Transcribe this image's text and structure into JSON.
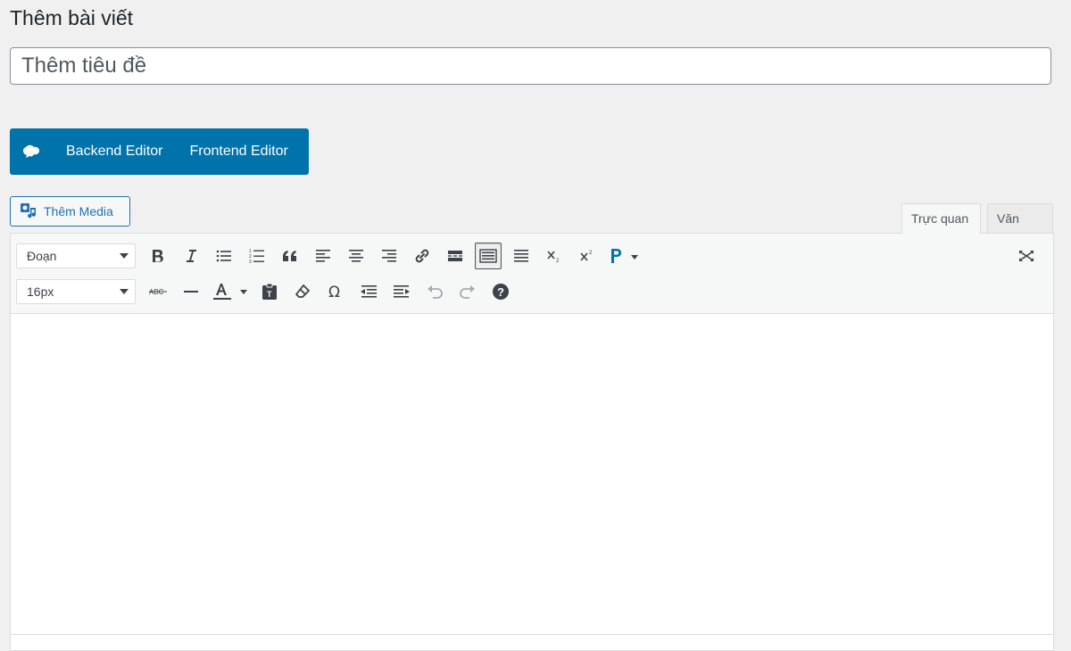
{
  "page": {
    "title": "Thêm bài viết"
  },
  "title_field": {
    "placeholder": "Thêm tiêu đề",
    "value": ""
  },
  "composer": {
    "backend": "Backend Editor",
    "frontend": "Frontend Editor"
  },
  "media": {
    "label": "Thêm Media"
  },
  "tabs": {
    "visual": "Trực quan",
    "text": "Văn bản"
  },
  "toolbar": {
    "format_select": "Đoạn",
    "font_size_select": "16px",
    "row1_icons": [
      "bold-icon",
      "italic-icon",
      "bullet-list-icon",
      "numbered-list-icon",
      "blockquote-icon",
      "align-left-icon",
      "align-center-icon",
      "align-right-icon",
      "link-icon",
      "read-more-icon",
      "toolbar-toggle-icon",
      "justify-icon",
      "subscript-icon",
      "superscript-icon",
      "p-icon"
    ],
    "row2_icons": [
      "strikethrough-icon",
      "horizontal-line-icon",
      "text-color-icon",
      "paste-text-icon",
      "clear-formatting-icon",
      "special-char-icon",
      "outdent-icon",
      "indent-icon",
      "undo-icon",
      "redo-icon",
      "help-icon"
    ]
  },
  "colors": {
    "accent": "#0073aa",
    "link": "#2271b1",
    "background": "#f0f0f1"
  }
}
